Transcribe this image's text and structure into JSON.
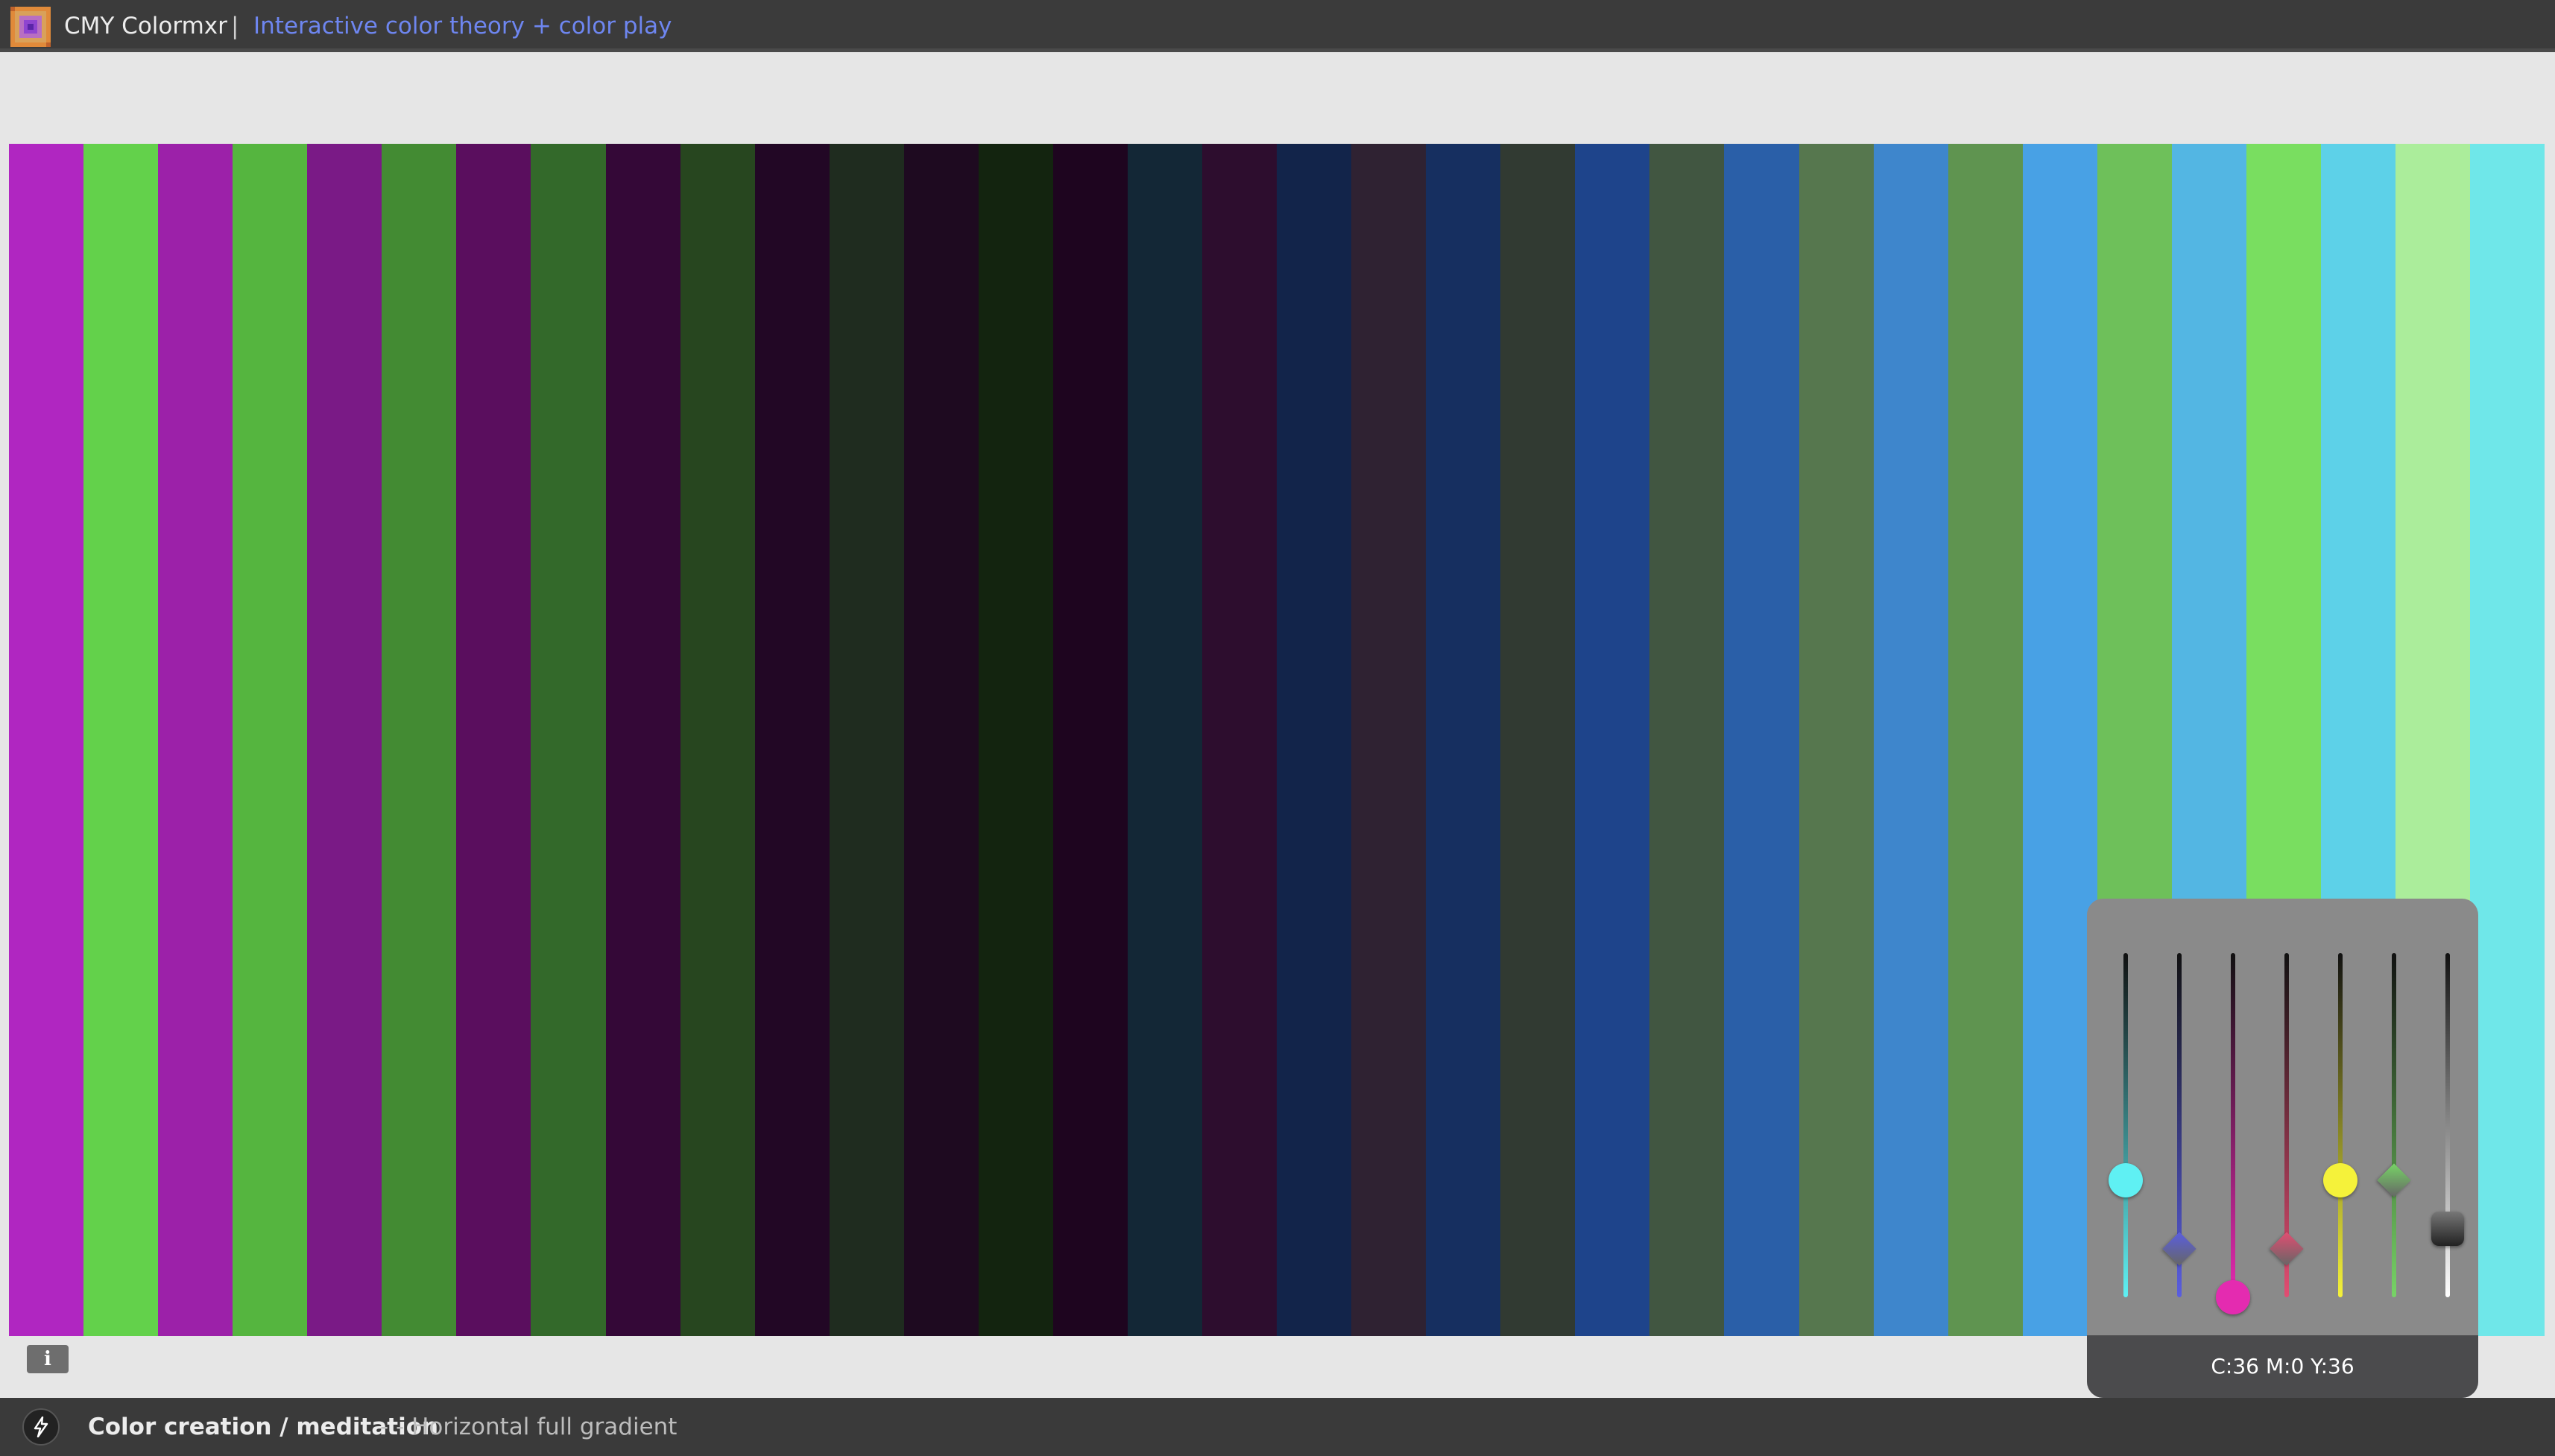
{
  "header": {
    "app_name": "CMY Colormxr",
    "separator": "|",
    "tagline": "Interactive color theory + color play",
    "tagline_color": "#6e86f0"
  },
  "canvas": {
    "stripe_colors": [
      "#b026c1",
      "#63d14b",
      "#9c21a9",
      "#55b53f",
      "#7a1a86",
      "#438b33",
      "#5a0e5e",
      "#33692a",
      "#340837",
      "#27461f",
      "#220725",
      "#1f2c1f",
      "#1e0a20",
      "#13240f",
      "#1e051f",
      "#132736",
      "#2d0d2e",
      "#12244a",
      "#2f2232",
      "#162f60",
      "#313a32",
      "#1e448b",
      "#415641",
      "#2a5fa8",
      "#56774e",
      "#3e86cc",
      "#5f9450",
      "#48a1e5",
      "#6ec05a",
      "#53b6e3",
      "#79de60",
      "#5dd1e8",
      "#abed9b",
      "#6fe7e9"
    ]
  },
  "info_button": {
    "label": "i"
  },
  "mixer": {
    "readout": "C:36 M:0 Y:36",
    "sliders": [
      {
        "name": "cyan",
        "level": 0.34,
        "color": "#5ff0f3"
      },
      {
        "name": "blue",
        "level": 0.14,
        "color": "#5a5ee0"
      },
      {
        "name": "magenta",
        "level": 0.0,
        "color": "#e42bb0"
      },
      {
        "name": "red",
        "level": 0.14,
        "color": "#e24d72"
      },
      {
        "name": "yellow",
        "level": 0.34,
        "color": "#f5f23a"
      },
      {
        "name": "green",
        "level": 0.34,
        "color": "#77d466"
      },
      {
        "name": "black",
        "level": 0.2,
        "color": "#333333"
      }
    ]
  },
  "footer": {
    "title": "Color creation / meditation",
    "mode": "- - Horizontal full gradient"
  }
}
